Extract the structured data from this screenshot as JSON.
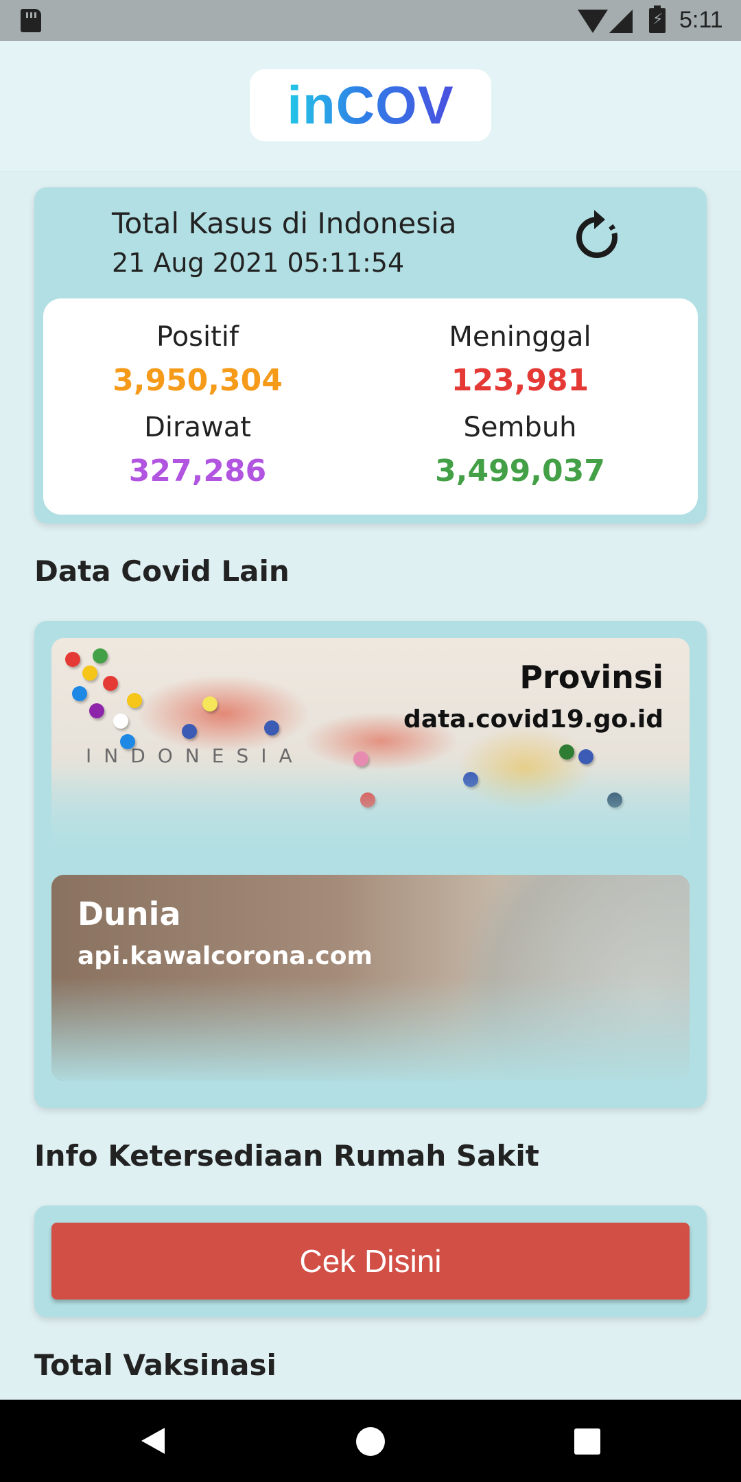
{
  "status_bar": {
    "time": "5:11"
  },
  "header": {
    "logo": "inCOV"
  },
  "total_card": {
    "title": "Total Kasus di Indonesia",
    "date": "21 Aug 2021 05:11:54",
    "refresh_icon": "refresh-icon",
    "stats": [
      {
        "label": "Positif",
        "value": "3,950,304",
        "color": "#f59a19"
      },
      {
        "label": "Meninggal",
        "value": "123,981",
        "color": "#e53935"
      },
      {
        "label": "Dirawat",
        "value": "327,286",
        "color": "#b154e0"
      },
      {
        "label": "Sembuh",
        "value": "3,499,037",
        "color": "#43a047"
      }
    ]
  },
  "sections": {
    "data_lain": "Data Covid Lain",
    "rumah_sakit": "Info Ketersediaan Rumah Sakit",
    "vaksinasi": "Total Vaksinasi"
  },
  "data_cards": {
    "provinsi": {
      "title": "Provinsi",
      "source": "data.covid19.go.id",
      "map_label": "INDONESIA"
    },
    "dunia": {
      "title": "Dunia",
      "source": "api.kawalcorona.com"
    }
  },
  "rumah_sakit": {
    "button_label": "Cek Disini"
  },
  "nav": {
    "back_icon": "back-icon",
    "home_icon": "home-icon",
    "recent_icon": "recent-apps-icon"
  }
}
